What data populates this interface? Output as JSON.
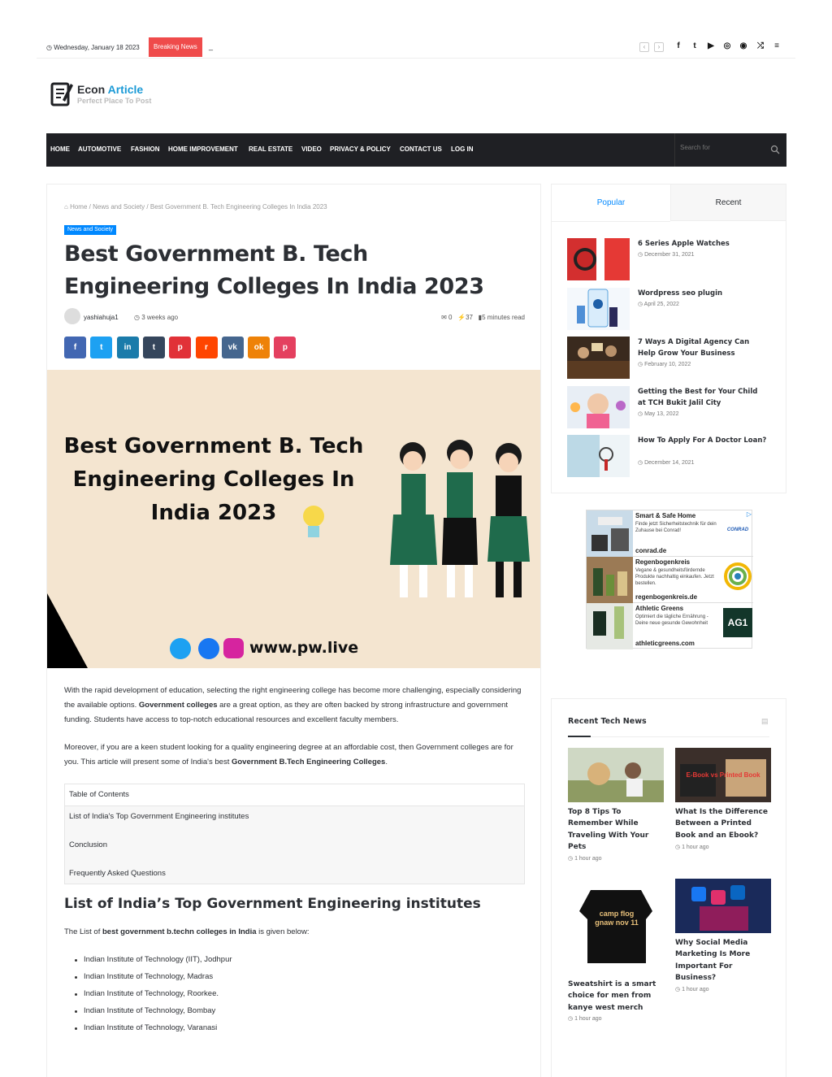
{
  "topbar": {
    "date": "Wednesday, January 18 2023",
    "breaking_label": "Breaking News",
    "ticker": "_"
  },
  "logo": {
    "name_a": "Econ",
    "name_b": "Article",
    "tagline": "Perfect Place To Post"
  },
  "nav": {
    "items": [
      "HOME",
      "AUTOMOTIVE",
      "FASHION",
      "HOME IMPROVEMENT",
      "REAL ESTATE",
      "VIDEO",
      "PRIVACY & POLICY",
      "CONTACT US",
      "LOG IN"
    ],
    "search_placeholder": "Search for"
  },
  "article": {
    "breadcrumb": {
      "home": "Home",
      "category": "News and Society",
      "current": "Best Government B. Tech Engineering Colleges In India 2023",
      "sep": "/"
    },
    "category_badge": "News and Society",
    "title": "Best Government B. Tech Engineering Colleges In India 2023",
    "author": "yashiahuja1",
    "time_ago": "3 weeks ago",
    "comments": "0",
    "views": "37",
    "read_time": "5 minutes read",
    "share_buttons": [
      {
        "icon": "facebook-icon",
        "glyph": "f",
        "color": "#4267b2"
      },
      {
        "icon": "twitter-icon",
        "glyph": "t",
        "color": "#1da1f2"
      },
      {
        "icon": "linkedin-icon",
        "glyph": "in",
        "color": "#1a7baa"
      },
      {
        "icon": "tumblr-icon",
        "glyph": "t",
        "color": "#35465c"
      },
      {
        "icon": "pinterest-icon",
        "glyph": "p",
        "color": "#e13138"
      },
      {
        "icon": "reddit-icon",
        "glyph": "r",
        "color": "#ff4500"
      },
      {
        "icon": "vk-icon",
        "glyph": "vk",
        "color": "#45668e"
      },
      {
        "icon": "odnoklassniki-icon",
        "glyph": "ok",
        "color": "#ee8208"
      },
      {
        "icon": "pocket-icon",
        "glyph": "p",
        "color": "#e4405f"
      }
    ],
    "hero": {
      "line1": "Best Government B. Tech",
      "line2": "Engineering Colleges In",
      "line3": "India 2023",
      "url": "www.pw.live"
    },
    "p1_a": "With the rapid development of education, selecting the right engineering college has become more challenging, especially considering the available options. ",
    "p1_b": "Government colleges",
    "p1_c": " are a great option, as they are often backed by strong infrastructure and government funding. Students have access to top-notch educational resources and excellent faculty members.",
    "p2_a": "Moreover, if you are a keen student looking for a quality engineering degree at an affordable cost, then Government colleges are for you. This article will present some of India's best ",
    "p2_b": "Government B.Tech Engineering Colleges",
    "p2_c": ".",
    "toc": {
      "heading": "Table of Contents",
      "items": [
        "List of India's Top Government Engineering institutes",
        "Conclusion",
        "Frequently Asked Questions"
      ]
    },
    "h2": "List of India’s Top Government Engineering institutes",
    "p3_a": "The List of ",
    "p3_b": "best government b.techn colleges in India",
    "p3_c": " is given below:",
    "list": [
      "Indian Institute of Technology (IIT), Jodhpur",
      "Indian Institute of Technology, Madras",
      "Indian Institute of Technology, Roorkee.",
      "Indian Institute of Technology, Bombay",
      "Indian Institute of Technology, Varanasi"
    ]
  },
  "sidebar": {
    "tabs": [
      "Popular",
      "Recent"
    ],
    "popular": [
      {
        "title": "6 Series Apple Watches",
        "date": "December 31, 2021"
      },
      {
        "title": "Wordpress seo plugin",
        "date": "April 25, 2022"
      },
      {
        "title": "7 Ways A Digital Agency Can Help Grow Your Business",
        "date": "February 10, 2022"
      },
      {
        "title": "Getting the Best for Your Child at TCH Bukit Jalil City",
        "date": "May 13, 2022"
      },
      {
        "title": "How To Apply For A Doctor Loan?",
        "date": "December 14, 2021"
      }
    ],
    "ads": [
      {
        "name": "Smart & Safe Home",
        "desc": "Finde jetzt Sicherheitstechnik für dein Zuhause bei Conrad!",
        "url": "conrad.de",
        "logo": "CONRAD"
      },
      {
        "name": "Regenbogenkreis",
        "desc": "Vegane & gesundheitsfördernde Produkte nachhaltig einkaufen. Jetzt bestellen.",
        "url": "regenbogenkreis.de",
        "logo": ""
      },
      {
        "name": "Athletic Greens",
        "desc": "Optimiert die tägliche Ernährung - Deine neue gesunde Gewohnheit",
        "url": "athleticgreens.com",
        "logo": "AG1"
      }
    ],
    "recent_heading": "Recent Tech News",
    "recent": [
      {
        "title": "Top 8 Tips To Remember While Traveling With Your Pets",
        "date": "1 hour ago"
      },
      {
        "title": "What Is the Difference Between a Printed Book and an Ebook?",
        "date": "1 hour ago",
        "thumb_text": "E-Book vs Printed Book"
      },
      {
        "title": "Sweatshirt is a smart choice for men from kanye west merch",
        "date": "1 hour ago",
        "thumb_text": "camp flog gnaw nov 11"
      },
      {
        "title": "Why Social Media Marketing Is More Important For Business?",
        "date": "1 hour ago"
      }
    ]
  }
}
